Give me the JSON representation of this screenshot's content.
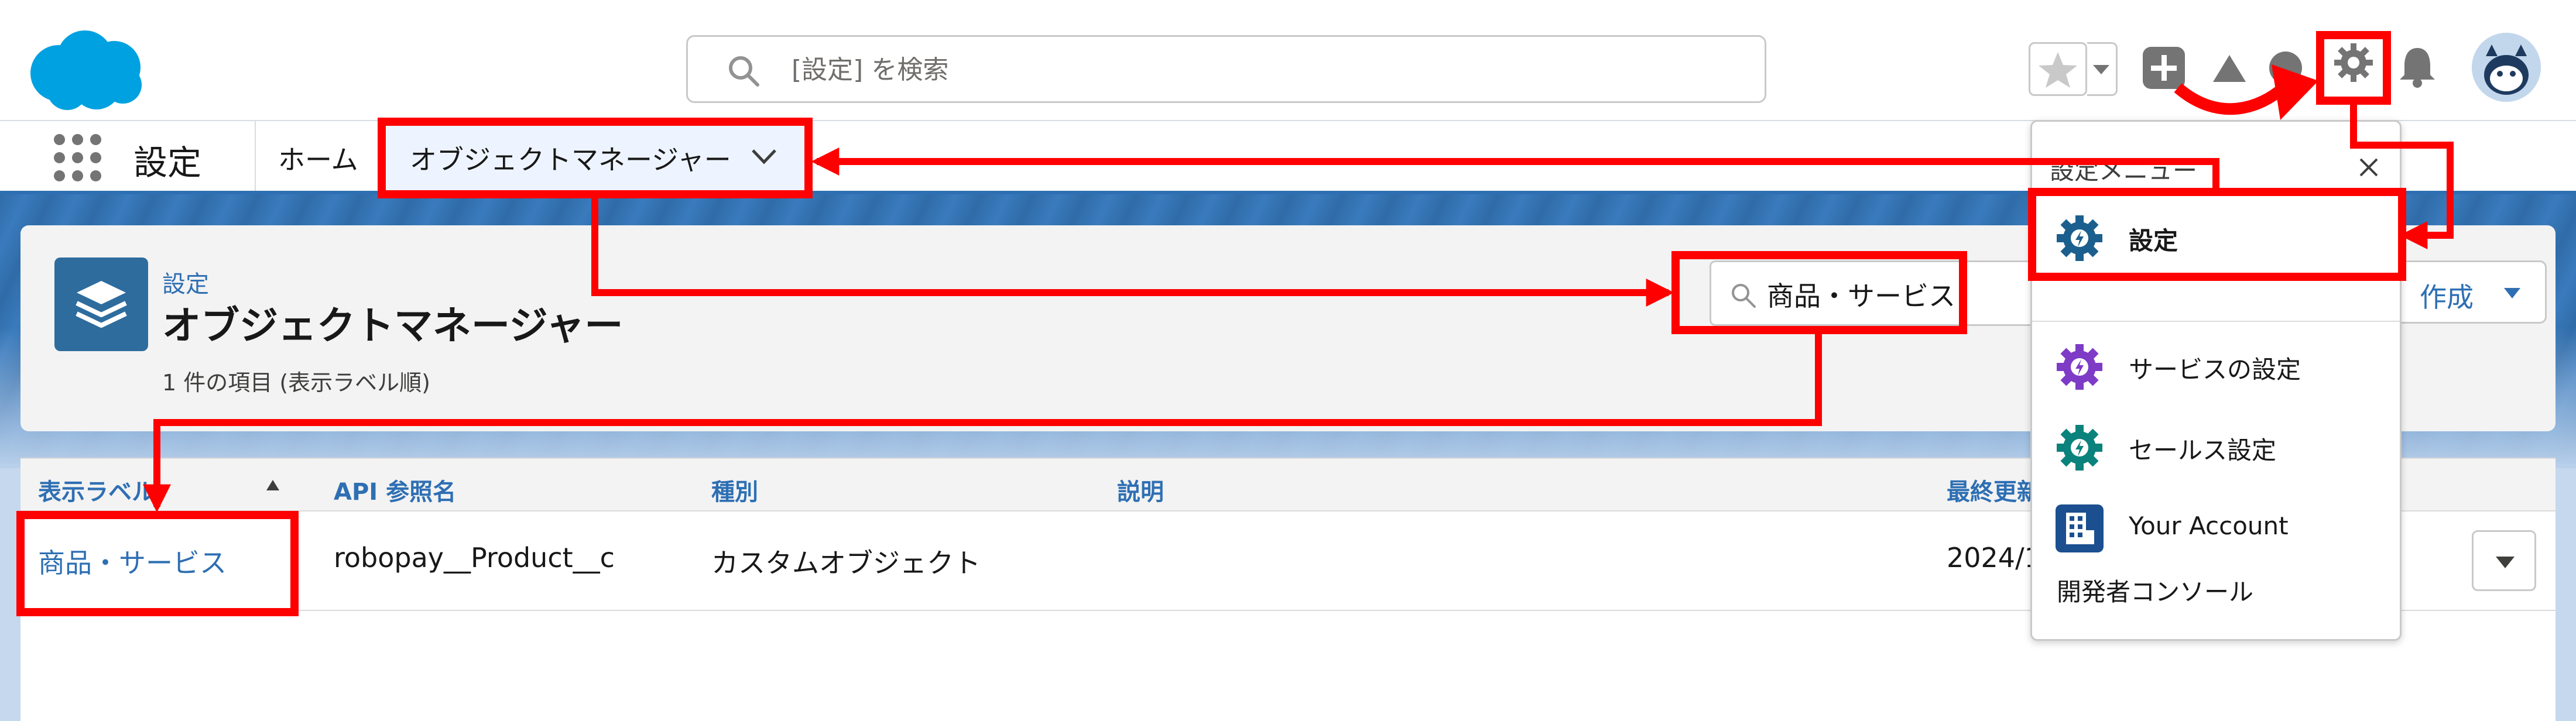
{
  "search": {
    "placeholder": "[設定] を検索"
  },
  "app": {
    "name": "設定"
  },
  "nav": {
    "tabs": [
      {
        "label": "ホーム"
      },
      {
        "label": "オブジェクトマネージャー"
      }
    ]
  },
  "page_header": {
    "breadcrumb": "設定",
    "title": "オブジェクトマネージャー",
    "item_count": "1 件の項目 (表示ラベル順)",
    "quickfind_value": "商品・サービス",
    "create_label": "作成"
  },
  "table": {
    "columns": [
      "表示ラベル",
      "API 参照名",
      "種別",
      "説明",
      "最終更新"
    ],
    "rows": [
      {
        "label": "商品・サービス",
        "api_name": "robopay__Product__c",
        "type": "カスタムオブジェクト",
        "description": "",
        "last_modified": "2024/1"
      }
    ]
  },
  "setup_menu": {
    "title": "設定メニュー",
    "items": [
      {
        "label": "設定",
        "icon": "setup-gear-icon",
        "color": "#1b5f8f"
      },
      {
        "label": "サービスの設定",
        "icon": "service-setup-icon",
        "color": "#7e3bc6"
      },
      {
        "label": "セールス設定",
        "icon": "sales-setup-icon",
        "color": "#0b827c"
      },
      {
        "label": "Your Account",
        "icon": "account-building-icon",
        "color": "#1b4f8f"
      }
    ],
    "developer_console": "開発者コンソール"
  },
  "colors": {
    "brand_blue": "#2e6fb3",
    "annotation_red": "#ff0000",
    "salesforce_cloud": "#00a1e0"
  }
}
